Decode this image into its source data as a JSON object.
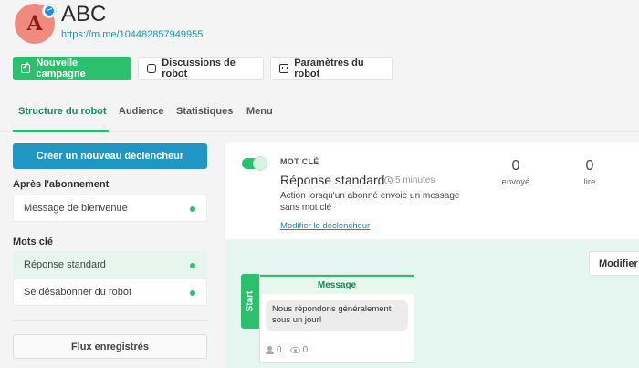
{
  "header": {
    "avatar_letter": "A",
    "title": "ABC",
    "link": "https://m.me/104482857949955"
  },
  "toolbar": {
    "new_campaign": "Nouvelle campagne",
    "discussions": "Discussions de robot",
    "settings": "Paramètres du robot"
  },
  "tabs": [
    {
      "label": "Structure du robot"
    },
    {
      "label": "Audience"
    },
    {
      "label": "Statistiques"
    },
    {
      "label": "Menu"
    }
  ],
  "sidebar": {
    "create_trigger": "Créer un nouveau déclencheur",
    "after_subscription_label": "Après l'abonnement",
    "after_items": [
      {
        "label": "Message de bienvenue"
      }
    ],
    "keywords_label": "Mots clé",
    "keyword_items": [
      {
        "label": "Réponse standard"
      },
      {
        "label": "Se désabonner du robot"
      }
    ],
    "saved_flows": "Flux enregistrés"
  },
  "card": {
    "type": "MOT CLÉ",
    "title": "Réponse standard",
    "time": "5 minutes",
    "description": "Action lorsqu'un abonné envoie un message sans mot clé",
    "modify_link": "Modifier le déclencheur",
    "stats": [
      {
        "value": "0",
        "label": "envoyé"
      },
      {
        "value": "0",
        "label": "lire"
      }
    ]
  },
  "canvas": {
    "modify_button": "Modifier l",
    "node": {
      "start_label": "Start",
      "header": "Message",
      "text": "Nous répondons généralement sous un jour!",
      "users_count": "0",
      "views_count": "0"
    }
  },
  "colors": {
    "green": "#2bc06b",
    "blue": "#1f96c3",
    "link": "#1a9bb0"
  }
}
